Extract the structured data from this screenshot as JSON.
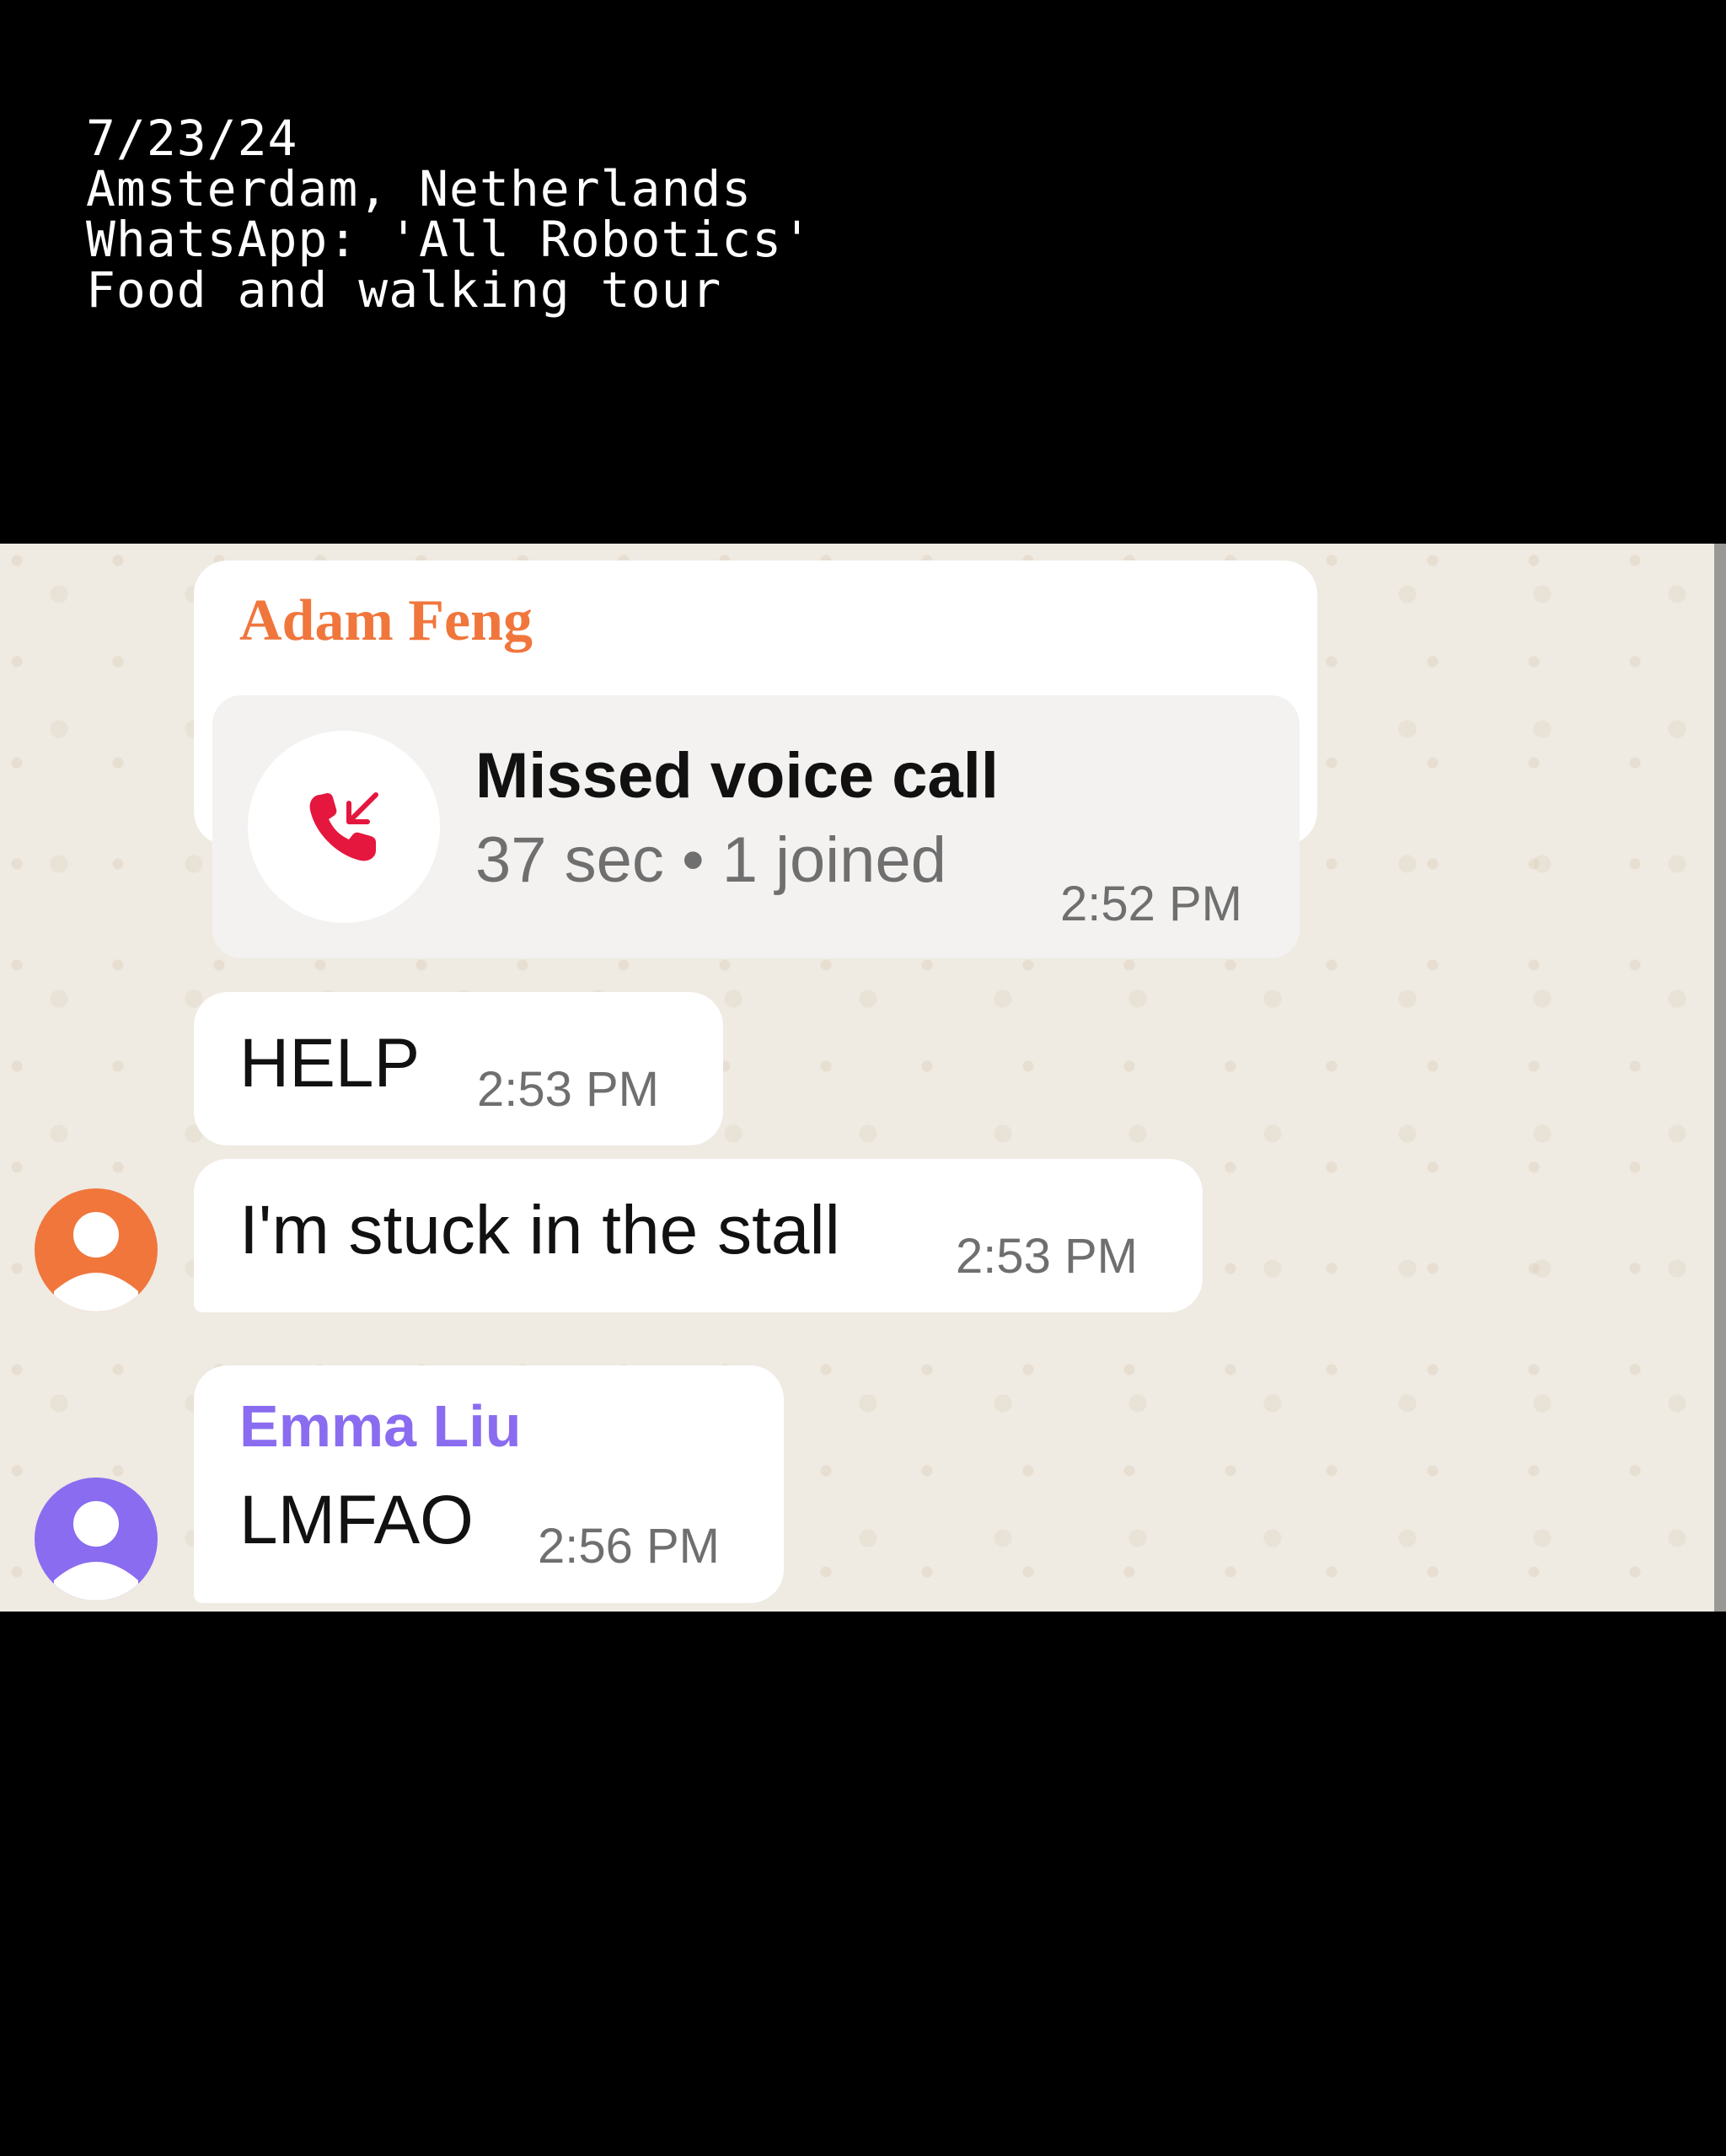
{
  "caption": {
    "date": "7/23/24",
    "location": "Amsterdam, Netherlands",
    "chat": "WhatsApp: 'All Robotics'",
    "topic": "Food and walking tour"
  },
  "messages": [
    {
      "sender": "Adam Feng",
      "sender_color": "#f0763c",
      "call": {
        "title": "Missed voice call",
        "details": "37 sec • 1 joined",
        "icon": "missed-call-icon",
        "icon_color": "#e5173f"
      },
      "time": "2:52 PM"
    },
    {
      "text": "HELP",
      "time": "2:53 PM"
    },
    {
      "text": "I'm stuck in the stall",
      "time": "2:53 PM",
      "avatar_color": "#f0763c",
      "avatar_icon": "person-icon"
    },
    {
      "sender": "Emma Liu",
      "sender_color": "#8a6cf0",
      "text": "LMFAO",
      "time": "2:56 PM",
      "avatar_color": "#8a6cf0",
      "avatar_icon": "person-icon"
    }
  ]
}
